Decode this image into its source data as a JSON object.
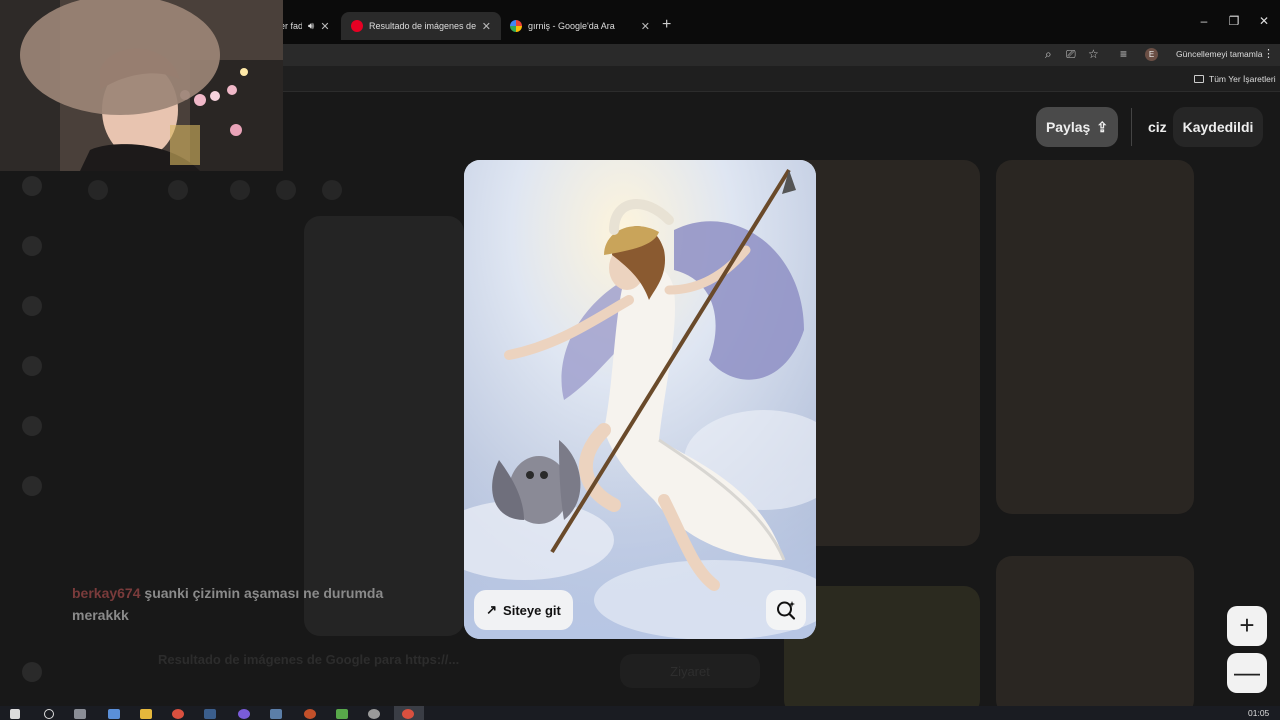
{
  "browser": {
    "tabs": [
      {
        "title": "er fad",
        "active": false,
        "favicon": "audio-tab-icon"
      },
      {
        "title": "Resultado de imágenes de Goo",
        "active": true,
        "favicon": "pinterest-icon"
      },
      {
        "title": "gırniş - Google'da Ara",
        "active": false,
        "favicon": "google-icon"
      }
    ],
    "new_tab": "+",
    "window_controls": {
      "minimize": "–",
      "restore": "❐",
      "close": "✕"
    },
    "profile_initial": "E",
    "update_label": "Güncellemeyi tamamla",
    "bookmarks_folder": "Tüm Yer İşaretleri"
  },
  "page": {
    "share_label": "Paylaş",
    "board_name": "ciz",
    "saved_label": "Kaydedildi",
    "visit_site_label": "Siteye git",
    "background_text": "Resultado de imágenes de Google para https://...",
    "background_button": "Ziyaret"
  },
  "chat": {
    "user": "berkay674",
    "message": "şuanki çizimin aşaması ne durumda merakkk"
  },
  "zoom": {
    "plus": "+",
    "minus": "—"
  },
  "taskbar": {
    "clock": "01:05"
  },
  "colors": {
    "accent_brand": "#e60023",
    "chat_user": "#7a3b3b"
  }
}
